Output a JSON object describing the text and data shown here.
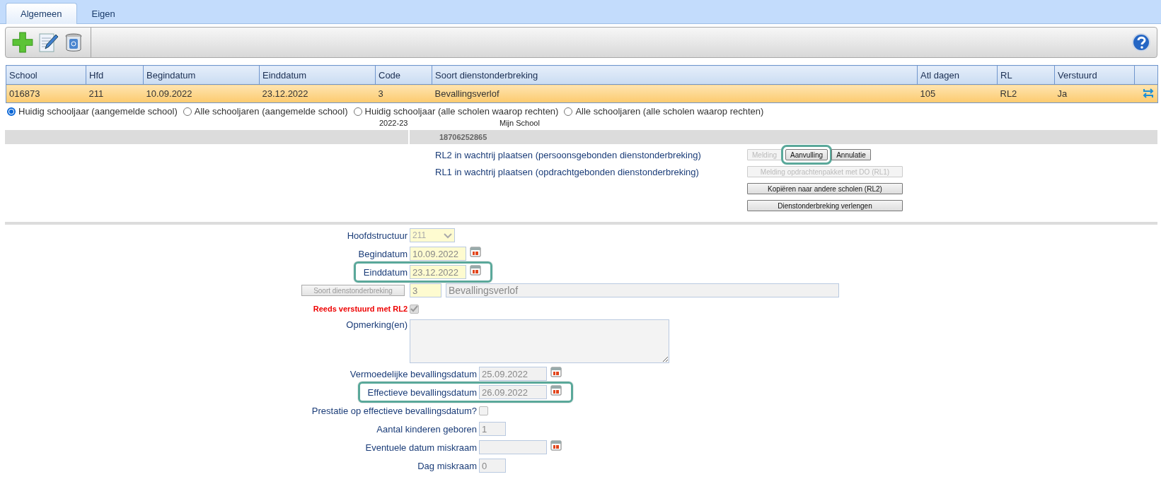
{
  "tabs": [
    {
      "label": "Algemeen",
      "selected": true
    },
    {
      "label": "Eigen",
      "selected": false
    }
  ],
  "table": {
    "columns": [
      "School",
      "Hfd",
      "Begindatum",
      "Einddatum",
      "Code",
      "Soort dienstonderbreking",
      "Atl dagen",
      "RL",
      "Verstuurd"
    ],
    "rows": [
      {
        "cells": [
          "016873",
          "211",
          "10.09.2022",
          "23.12.2022",
          "3",
          "Bevallingsverlof",
          "105",
          "RL2",
          "Ja"
        ],
        "selected": true
      }
    ]
  },
  "scope_options": [
    {
      "label": "Huidig schooljaar (aangemelde school)",
      "selected": true
    },
    {
      "label": "Alle schooljaren (aangemelde school)",
      "selected": false
    },
    {
      "label": "Huidig schooljaar (alle scholen waarop rechten)",
      "selected": false
    },
    {
      "label": "Alle schooljaren (alle scholen waarop rechten)",
      "selected": false
    }
  ],
  "info": {
    "school_year": "2022-23",
    "school": "Mijn School",
    "number": "18706252865"
  },
  "actions": [
    {
      "label": "RL2 in wachtrij plaatsen (persoonsgebonden dienstonderbreking)",
      "buttons": [
        {
          "label": "Melding",
          "disabled": true,
          "highlighted": false
        },
        {
          "label": "Aanvulling",
          "disabled": false,
          "highlighted": true
        },
        {
          "label": "Annulatie",
          "disabled": false,
          "highlighted": false
        }
      ]
    },
    {
      "label": "RL1 in wachtrij plaatsen (opdrachtgebonden dienstonderbreking)",
      "buttons": [
        {
          "label": "Melding opdrachtenpakket met DO (RL1)",
          "disabled": true,
          "highlighted": false
        }
      ]
    },
    {
      "buttons": [
        {
          "label": "Kopiëren naar andere scholen (RL2)",
          "disabled": false,
          "highlighted": false
        }
      ]
    },
    {
      "buttons": [
        {
          "label": "Dienstonderbreking verlengen",
          "disabled": false,
          "highlighted": false
        }
      ]
    }
  ],
  "form": {
    "groups": [
      {
        "fields": [
          {
            "kind": "select",
            "label": "Hoofdstructuur",
            "value": "211",
            "disabled": true
          },
          {
            "kind": "date",
            "label": "Begindatum",
            "value": "10.09.2022",
            "mandatory": true,
            "highlighted": false
          },
          {
            "kind": "date",
            "label": "Einddatum",
            "value": "23.12.2022",
            "mandatory": true,
            "highlighted": true
          },
          {
            "kind": "code",
            "button": "Soort dienstonderbreking",
            "code": "3",
            "description": "Bevallingsverlof"
          },
          {
            "kind": "checkbox",
            "label": "Reeds verstuurd met RL2",
            "checked": true,
            "warning": true
          },
          {
            "kind": "textarea",
            "label": "Opmerking(en)"
          }
        ]
      },
      {
        "fields": [
          {
            "kind": "date",
            "label": "Vermoedelijke bevallingsdatum",
            "value": "25.09.2022",
            "mandatory": false,
            "highlighted": false
          },
          {
            "kind": "date",
            "label": "Effectieve bevallingsdatum",
            "value": "26.09.2022",
            "mandatory": false,
            "highlighted": true
          },
          {
            "kind": "checkbox",
            "label": "Prestatie op effectieve bevallingsdatum?",
            "checked": false,
            "warning": false
          },
          {
            "kind": "number",
            "label": "Aantal kinderen geboren",
            "value": "1"
          },
          {
            "kind": "date",
            "label": "Eventuele datum miskraam",
            "mandatory": false,
            "highlighted": false
          },
          {
            "kind": "number",
            "label": "Dag miskraam",
            "value": "0"
          }
        ]
      }
    ]
  }
}
